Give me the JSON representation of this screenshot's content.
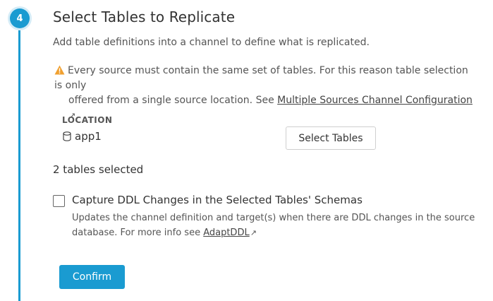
{
  "step": {
    "number": "4",
    "title": "Select Tables to Replicate",
    "subtitle": "Add table definitions into a channel to define what is replicated."
  },
  "warning": {
    "icon": "warning-triangle-icon",
    "text_line1": "Every source must contain the same set of tables. For this reason table selection is only",
    "text_line2": "offered from a single source location. See ",
    "link_text": "Multiple Sources Channel Configuration",
    "link_arrow": "↗"
  },
  "location": {
    "header": "LOCATION",
    "icon": "database-icon",
    "name": "app1",
    "select_button": "Select Tables"
  },
  "selection": {
    "count_text": "2 tables selected"
  },
  "ddl": {
    "checked": false,
    "label": "Capture DDL Changes in the Selected Tables' Schemas",
    "desc_line1": "Updates the channel definition and target(s) when there are DDL changes in the source",
    "desc_line2": "database. For more info see ",
    "link_text": "AdaptDDL",
    "link_arrow": "↗"
  },
  "actions": {
    "confirm": "Confirm"
  },
  "colors": {
    "accent": "#1a9bd1",
    "warning": "#f0a030"
  }
}
